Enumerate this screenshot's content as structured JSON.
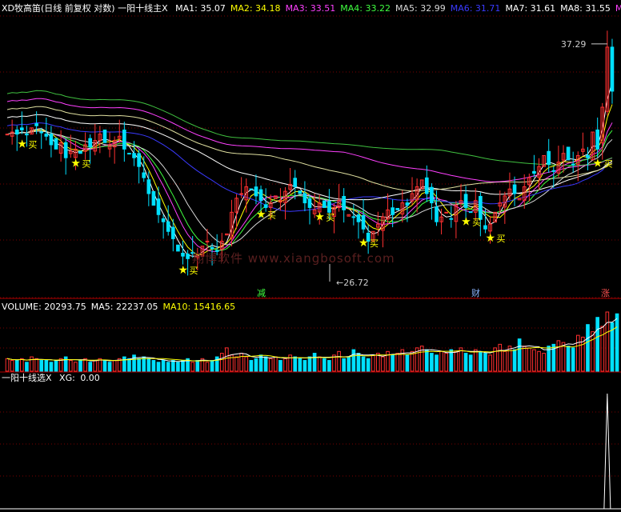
{
  "main": {
    "title": "XD牧高笛(日线 前复权 对数) 一阳十线主X",
    "ma": [
      {
        "label": "MA1:",
        "value": "35.07",
        "color": "#ffffff"
      },
      {
        "label": "MA2:",
        "value": "34.18",
        "color": "#ffff00"
      },
      {
        "label": "MA3:",
        "value": "33.51",
        "color": "#ff40ff"
      },
      {
        "label": "MA4:",
        "value": "33.22",
        "color": "#40ff40"
      },
      {
        "label": "MA5:",
        "value": "32.99",
        "color": "#d8d8d8"
      },
      {
        "label": "MA6:",
        "value": "31.71",
        "color": "#3a3aff"
      },
      {
        "label": "MA7:",
        "value": "31.61",
        "color": "#ffffff"
      },
      {
        "label": "MA8:",
        "value": "31.55",
        "color": "#ffffff"
      },
      {
        "label": "MA",
        "value": "",
        "color": "#ff40ff"
      }
    ],
    "high_label": "37.29",
    "low_label": "26.72",
    "buy_label": "买",
    "watermark": "翔博软件 www.xiangbosoft.com",
    "date_tags": [
      {
        "text": "减",
        "color": "#40ff40"
      },
      {
        "text": "财",
        "color": "#8ab4ff"
      },
      {
        "text": "涨",
        "color": "#ff5050"
      }
    ]
  },
  "volume_panel": {
    "items": [
      {
        "label": "VOLUME:",
        "value": "20293.75",
        "color": "#ffffff"
      },
      {
        "label": "MA5:",
        "value": "22237.05",
        "color": "#ffffff"
      },
      {
        "label": "MA10:",
        "value": "15416.65",
        "color": "#ffff00"
      }
    ]
  },
  "indicator_panel": {
    "title": "一阳十线选X",
    "xg_label": "XG:",
    "xg_value": "0.00"
  },
  "colors": {
    "up": "#ff3030",
    "down": "#00e0ff",
    "buy_star": "#ffff00",
    "pink_bar": "#ff40ff",
    "grid": "#7a0000"
  },
  "chart_data": {
    "type": "candlestick",
    "y_scale": "log",
    "ylim": [
      26.0,
      39.0
    ],
    "close": [
      32.9,
      33.0,
      32.9,
      33.1,
      32.9,
      33.2,
      33.3,
      33.0,
      32.8,
      32.4,
      32.2,
      32.5,
      31.8,
      32.1,
      32.2,
      32.0,
      32.4,
      32.3,
      32.6,
      32.9,
      32.5,
      32.4,
      32.6,
      32.8,
      32.2,
      32.0,
      31.8,
      31.4,
      30.9,
      30.2,
      29.7,
      29.3,
      29.0,
      28.6,
      28.3,
      27.8,
      27.6,
      27.5,
      27.7,
      27.6,
      28.0,
      28.2,
      27.9,
      27.8,
      28.2,
      28.5,
      29.4,
      30.0,
      30.2,
      30.5,
      30.4,
      30.1,
      29.9,
      29.6,
      29.8,
      30.1,
      29.9,
      30.3,
      30.6,
      30.5,
      30.2,
      29.8,
      29.6,
      29.5,
      29.8,
      29.6,
      29.4,
      29.6,
      29.9,
      29.5,
      29.3,
      29.2,
      29.0,
      28.7,
      28.2,
      28.6,
      28.9,
      29.2,
      29.5,
      29.3,
      29.5,
      29.8,
      29.7,
      30.2,
      30.5,
      30.8,
      30.2,
      29.8,
      29.0,
      29.2,
      29.4,
      29.1,
      29.7,
      29.9,
      29.6,
      29.4,
      29.9,
      29.1,
      28.7,
      28.9,
      29.4,
      29.8,
      30.1,
      30.4,
      30.2,
      30.0,
      30.5,
      30.9,
      31.1,
      31.4,
      31.9,
      31.5,
      31.2,
      31.6,
      32.0,
      31.7,
      31.5,
      31.9,
      32.2,
      31.8,
      33.0,
      32.2,
      34.2,
      37.29,
      35.0
    ],
    "volume": [
      7,
      6,
      6,
      7,
      5,
      8,
      7,
      6,
      6,
      5,
      6,
      7,
      8,
      6,
      5,
      6,
      7,
      5,
      6,
      7,
      6,
      5,
      6,
      7,
      8,
      7,
      9,
      7,
      8,
      7,
      6,
      5,
      6,
      5,
      6,
      5,
      6,
      7,
      5,
      6,
      7,
      5,
      6,
      8,
      10,
      13,
      9,
      8,
      10,
      8,
      6,
      7,
      9,
      8,
      7,
      8,
      6,
      7,
      9,
      8,
      7,
      6,
      8,
      10,
      8,
      7,
      6,
      9,
      11,
      7,
      8,
      12,
      10,
      8,
      7,
      9,
      10,
      8,
      11,
      9,
      10,
      12,
      9,
      11,
      13,
      14,
      12,
      10,
      9,
      11,
      10,
      12,
      11,
      13,
      10,
      9,
      12,
      11,
      10,
      9,
      13,
      15,
      11,
      14,
      12,
      18,
      14,
      13,
      12,
      11,
      10,
      14,
      15,
      17,
      16,
      14,
      13,
      20,
      19,
      26,
      22,
      30,
      25,
      33,
      27,
      32
    ]
  }
}
